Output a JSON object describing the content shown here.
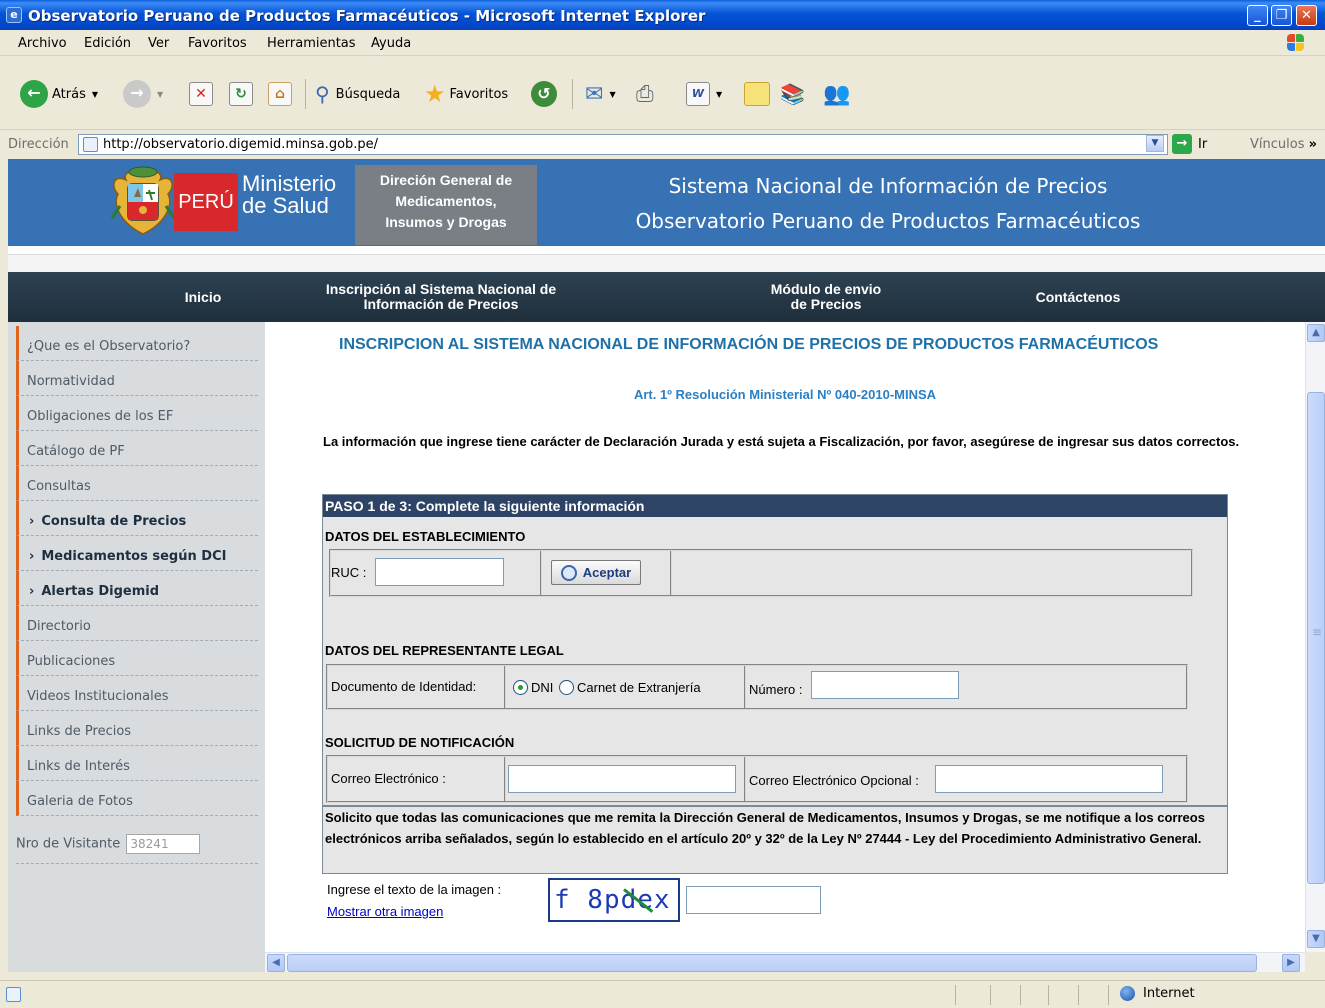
{
  "window": {
    "title": "Observatorio Peruano de Productos Farmacéuticos - Microsoft Internet Explorer"
  },
  "menu": [
    "Archivo",
    "Edición",
    "Ver",
    "Favoritos",
    "Herramientas",
    "Ayuda"
  ],
  "toolbar": {
    "back_label": "Atrás",
    "search_label": "Búsqueda",
    "favorites_label": "Favoritos"
  },
  "address": {
    "label": "Dirección",
    "url": "http://observatorio.digemid.minsa.gob.pe/",
    "go_label": "Ir",
    "links_label": "Vínculos"
  },
  "banner": {
    "peru": "PERÚ",
    "ministry_line1": "Ministerio",
    "ministry_line2": "de Salud",
    "digemid_line1": "Direción General de",
    "digemid_line2": "Medicamentos,",
    "digemid_line3": "Insumos y Drogas",
    "title_line1": "Sistema Nacional de Información de Precios",
    "title_line2": "Observatorio Peruano de Productos Farmacéuticos"
  },
  "nav": {
    "home": "Inicio",
    "inscription_line1": "Inscripción al Sistema Nacional de",
    "inscription_line2": "Información de Precios",
    "module_line1": "Módulo de envio",
    "module_line2": "de Precios",
    "contact": "Contáctenos"
  },
  "sidebar": {
    "items": [
      "¿Que es el Observatorio?",
      "Normatividad",
      "Obligaciones de los EF",
      "Catálogo de PF",
      "Consultas",
      "Consulta de Precios",
      "Medicamentos según DCI",
      "Alertas Digemid",
      "Directorio",
      "Publicaciones",
      "Videos Institucionales",
      "Links de Precios",
      "Links de Interés",
      "Galeria de Fotos"
    ],
    "visitor_label": "Nro de Visitante",
    "visitor_count": "38241"
  },
  "main": {
    "heading": "INSCRIPCION AL SISTEMA NACIONAL DE INFORMACIÓN DE PRECIOS DE PRODUCTOS FARMACÉUTICOS",
    "subheading": "Art. 1º Resolución Ministerial Nº 040-2010-MINSA",
    "declaration": "La información que ingrese tiene carácter de Declaración Jurada y está sujeta a Fiscalización, por favor, asegúrese de ingresar sus datos correctos.",
    "step": "PASO 1 de 3: Complete la siguiente información",
    "section_establishment": "DATOS DEL ESTABLECIMIENTO",
    "ruc_label": "RUC :",
    "accept_button": "Aceptar",
    "section_representative": "DATOS DEL REPRESENTANTE LEGAL",
    "doc_label": "Documento de Identidad:",
    "doc_option_dni": "DNI",
    "doc_option_ce": "Carnet de Extranjería",
    "doc_selected": "DNI",
    "number_label": "Número :",
    "section_notification": "SOLICITUD DE NOTIFICACIÓN",
    "email_label": "Correo Electrónico :",
    "email_optional_label": "Correo Electrónico Opcional :",
    "notice": "Solicito que todas las comunicaciones que me remita la Dirección General de Medicamentos, Insumos y Drogas, se me notifique a los correos electrónicos arriba señalados, según lo establecido en el artículo 20º y 32º de la Ley Nº 27444 - Ley del Procedimiento Administrativo General.",
    "captcha_label": "Ingrese el texto de la imagen :",
    "captcha_link": "Mostrar otra imagen",
    "captcha_text": "f 8pdex"
  },
  "status": {
    "zone": "Internet"
  },
  "colors": {
    "banner_blue": "#3672B4",
    "nav_dark": "#26394A",
    "heading_blue": "#1F71A8",
    "sidebar_accent": "#E0641D",
    "step_bar": "#2E4466"
  }
}
